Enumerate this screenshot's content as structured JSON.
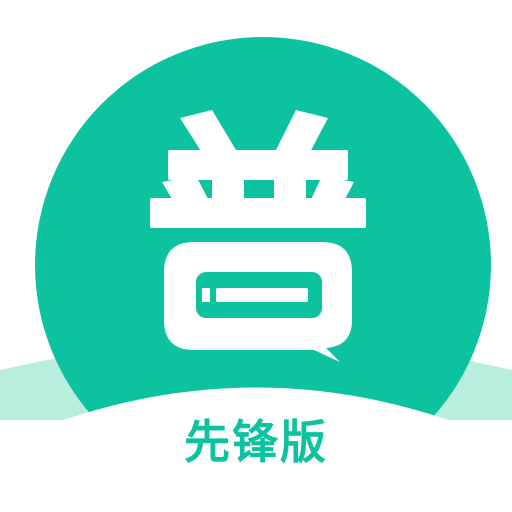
{
  "app_icon": {
    "logo_char": "普",
    "edition_label": "先锋版",
    "icon_name": "speech-bubble-icon"
  },
  "colors": {
    "brand_green": "#0DC39F",
    "mint_band": "#B9EEDF",
    "background": "#FFFFFF",
    "logo_white": "#FFFFFF"
  }
}
